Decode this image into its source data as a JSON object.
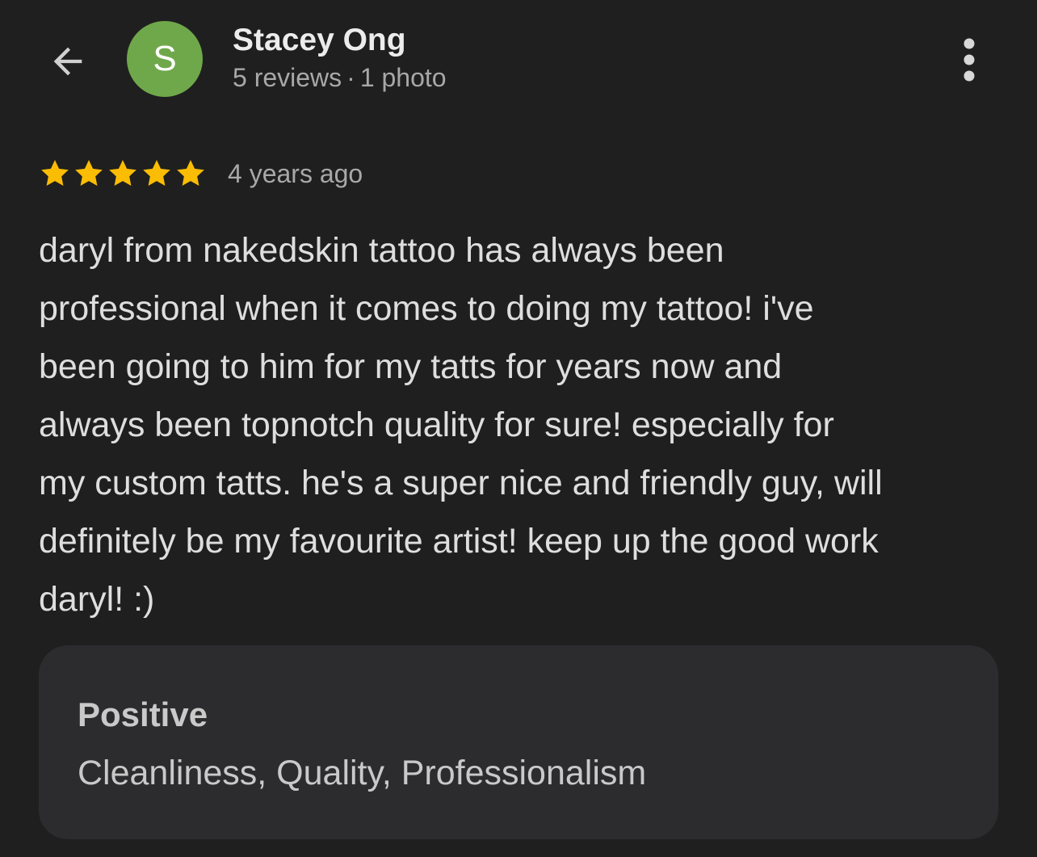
{
  "header": {
    "back_icon": "arrow-left-icon",
    "avatar_letter": "S",
    "avatar_color": "#6fa84a",
    "reviewer_name": "Stacey Ong",
    "reviews_count": "5 reviews",
    "separator": "·",
    "photos_count": "1 photo",
    "more_icon": "more-vert-icon"
  },
  "review": {
    "rating": 5,
    "rating_max": 5,
    "star_color": "#fbbc04",
    "time_ago": "4 years ago",
    "text_lines": [
      "daryl from nakedskin tattoo has always been",
      "professional when it comes to doing my tattoo! i've",
      "been going to him for my tatts for years now and",
      "always been topnotch quality for sure! especially for",
      "my custom tatts. he's a super nice and friendly guy, will",
      "definitely be my favourite artist! keep up the good work",
      "daryl! :)"
    ]
  },
  "attributes": {
    "heading": "Positive",
    "values": "Cleanliness, Quality, Professionalism"
  }
}
